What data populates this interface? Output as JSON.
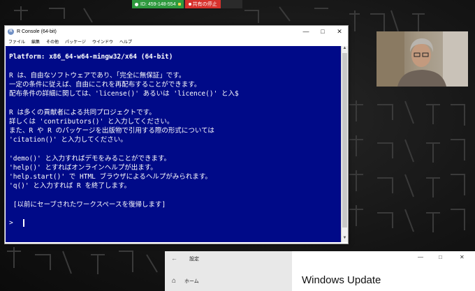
{
  "share_bar": {
    "meeting_id": "ID: 459-148-554",
    "stop_label": "共有の停止"
  },
  "r_console": {
    "title": "R Console (64-bit)",
    "logo_letter": "R",
    "menu": [
      "ファイル",
      "編集",
      "その他",
      "パッケージ",
      "ウインドウ",
      "ヘルプ"
    ],
    "lines": [
      "Platform: x86_64-w64-mingw32/x64 (64-bit)",
      "",
      "R は、自由なソフトウェアであり、「完全に無保証」です。",
      "一定の条件に従えば、自由にこれを再配布することができます。",
      "配布条件の詳細に関しては、'license()' あるいは 'licence()' と入$",
      "",
      "R は多くの貢献者による共同プロジェクトです。",
      "詳しくは 'contributors()' と入力してください。",
      "また、R や R のパッケージを出版物で引用する際の形式については",
      "'citation()' と入力してください。",
      "",
      "'demo()' と入力すればデモをみることができます。",
      "'help()' とすればオンラインヘルプが出ます。",
      "'help.start()' で HTML ブラウザによるヘルプがみられます。",
      "'q()' と入力すれば R を終了します。",
      "",
      " [以前にセーブされたワークスペースを復帰します]",
      "",
      "> "
    ]
  },
  "settings_window": {
    "title": "設定",
    "home_label": "ホーム",
    "page_heading": "Windows Update"
  },
  "colors": {
    "console_bg": "#000a88",
    "share_green": "#2e9a3e",
    "share_red": "#d8322d"
  }
}
